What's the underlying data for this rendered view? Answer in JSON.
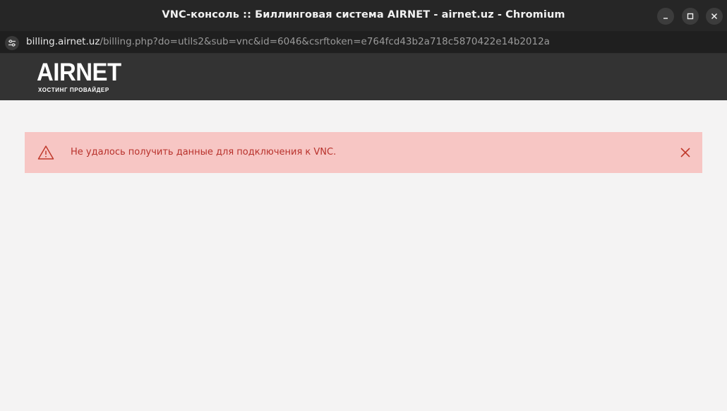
{
  "window": {
    "title": "VNC-консоль :: Биллинговая система AIRNET - airnet.uz - Chromium",
    "controls": [
      "minimize",
      "maximize",
      "close"
    ]
  },
  "address_bar": {
    "host": "billing.airnet.uz",
    "path": "/billing.php?do=utils2&sub=vnc&id=6046&csrftoken=e764fcd43b2a718c5870422e14b2012a",
    "icon": "site-settings-icon"
  },
  "header": {
    "logo_text": "AIRNET",
    "logo_tagline": "ХОСТИНГ ПРОВАЙДЕР"
  },
  "alert": {
    "icon": "warning-triangle-icon",
    "message": "Не удалось получить данные для подключения к VNC.",
    "close_icon": "close-icon",
    "colors": {
      "background": "#f7c6c4",
      "text": "#b8312b"
    }
  }
}
